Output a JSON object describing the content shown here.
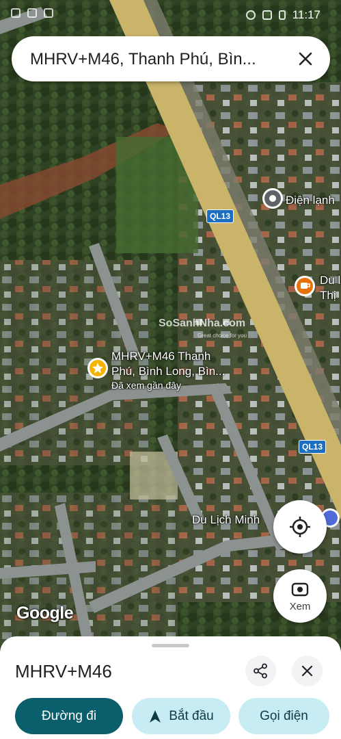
{
  "status_bar": {
    "time": "11:17"
  },
  "search": {
    "query": "MHRV+M46, Thanh Phú, Bìn..."
  },
  "map": {
    "roads": [
      {
        "shield": "QL13"
      },
      {
        "shield": "QL13"
      }
    ],
    "places": [
      {
        "name": "Điện lạnh",
        "icon": "place-pin-icon"
      },
      {
        "name": "Du l",
        "line2": "Thị",
        "icon": "cafe-icon"
      },
      {
        "name": "Du Lịch Minh",
        "icon": ""
      }
    ],
    "selected_place": {
      "line1": "MHRV+M46 Thanh",
      "line2": "Phú, Bình Long, Bìn...",
      "line3": "Đã xem gần đây",
      "icon": "star-icon"
    },
    "watermark": {
      "brand": "SoSanhNha.com",
      "tagline": "Great choice for you"
    },
    "attribution": "Google"
  },
  "controls": {
    "locate_icon": "my-location-icon",
    "view_label": "Xem",
    "view_icon": "camera-lens-icon"
  },
  "sheet": {
    "title": "MHRV+M46",
    "share_icon": "share-icon",
    "close_icon": "close-icon",
    "chips": [
      {
        "label": "Đường đi",
        "icon": "directions-icon"
      },
      {
        "label": "Bắt đầu",
        "icon": "navigation-arrow-icon"
      },
      {
        "label": "Gọi điện",
        "icon": "phone-icon"
      }
    ]
  },
  "colors": {
    "primary_chip": "#0b5e6b",
    "secondary_chip": "#c7ecf3",
    "road_shield": "#1c6ec1",
    "highway": "#c9b46a",
    "selected_pin": "#f4b400",
    "cafe_pin": "#e8710a",
    "place_pin": "#5f6368"
  }
}
